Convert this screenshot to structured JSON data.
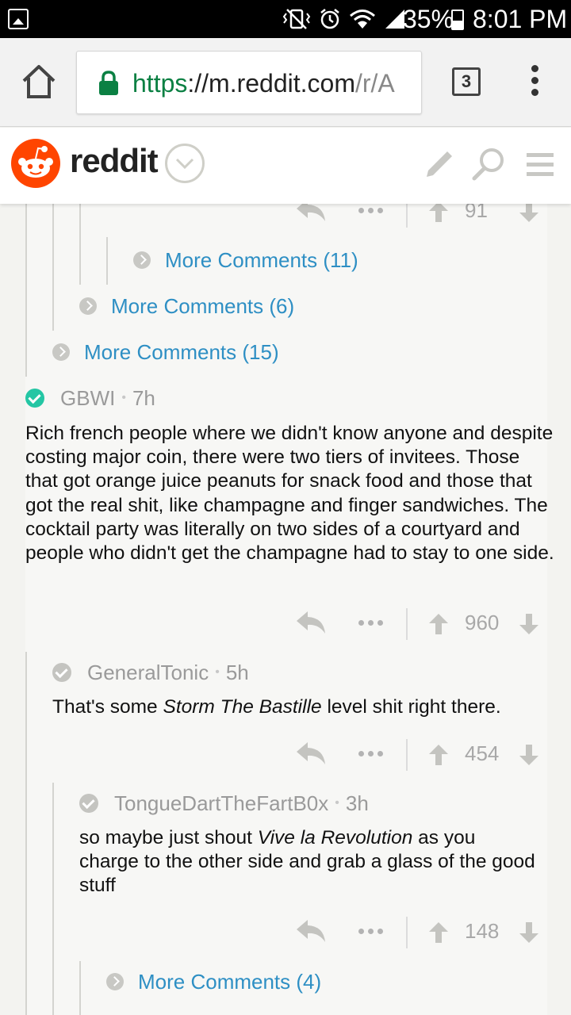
{
  "status_bar": {
    "battery": "35%",
    "time": "8:01 PM",
    "icons": [
      "gallery-icon",
      "vibrate-icon",
      "alarm-icon",
      "wifi-icon",
      "signal-icon",
      "battery-icon"
    ]
  },
  "browser": {
    "url_scheme": "https",
    "url_host": "://m.reddit.com",
    "url_path": "/r/A",
    "tab_count": "3",
    "colors": {
      "secure": "#0b8043"
    }
  },
  "header": {
    "brand": "reddit",
    "colors": {
      "logo": "#ff4500"
    },
    "icons": [
      "reddit-logo-icon",
      "chevron-down-icon",
      "pencil-icon",
      "search-icon",
      "hamburger-menu-icon"
    ]
  },
  "thread": {
    "top_partial_score": "91",
    "more_comments": [
      {
        "label": "More Comments (11)"
      },
      {
        "label": "More Comments (6)"
      },
      {
        "label": "More Comments (15)"
      }
    ],
    "comments": [
      {
        "author": "GBWI",
        "age": "7h",
        "verified_color": "#24c6a4",
        "text": "Rich french people where we didn't know anyone and despite costing major coin, there were two tiers of invitees. Those that got orange juice peanuts for snack food and those that got the real shit, like champagne and finger sandwiches. The cocktail party was literally on two sides of a courtyard and people who didn't get the champagne had to stay to one side.",
        "score": "960"
      },
      {
        "author": "GeneralTonic",
        "age": "5h",
        "text_before": "That's some ",
        "text_em": "Storm The Bastille",
        "text_after": " level shit right there.",
        "score": "454"
      },
      {
        "author": "TongueDartTheFartB0x",
        "age": "3h",
        "text_before": "so maybe just shout ",
        "text_em": "Vive la Revolution",
        "text_after": " as you charge to the other side and grab a glass of the good stuff",
        "score": "148"
      }
    ],
    "more_comments_bottom": {
      "label": "More Comments (4)"
    }
  }
}
